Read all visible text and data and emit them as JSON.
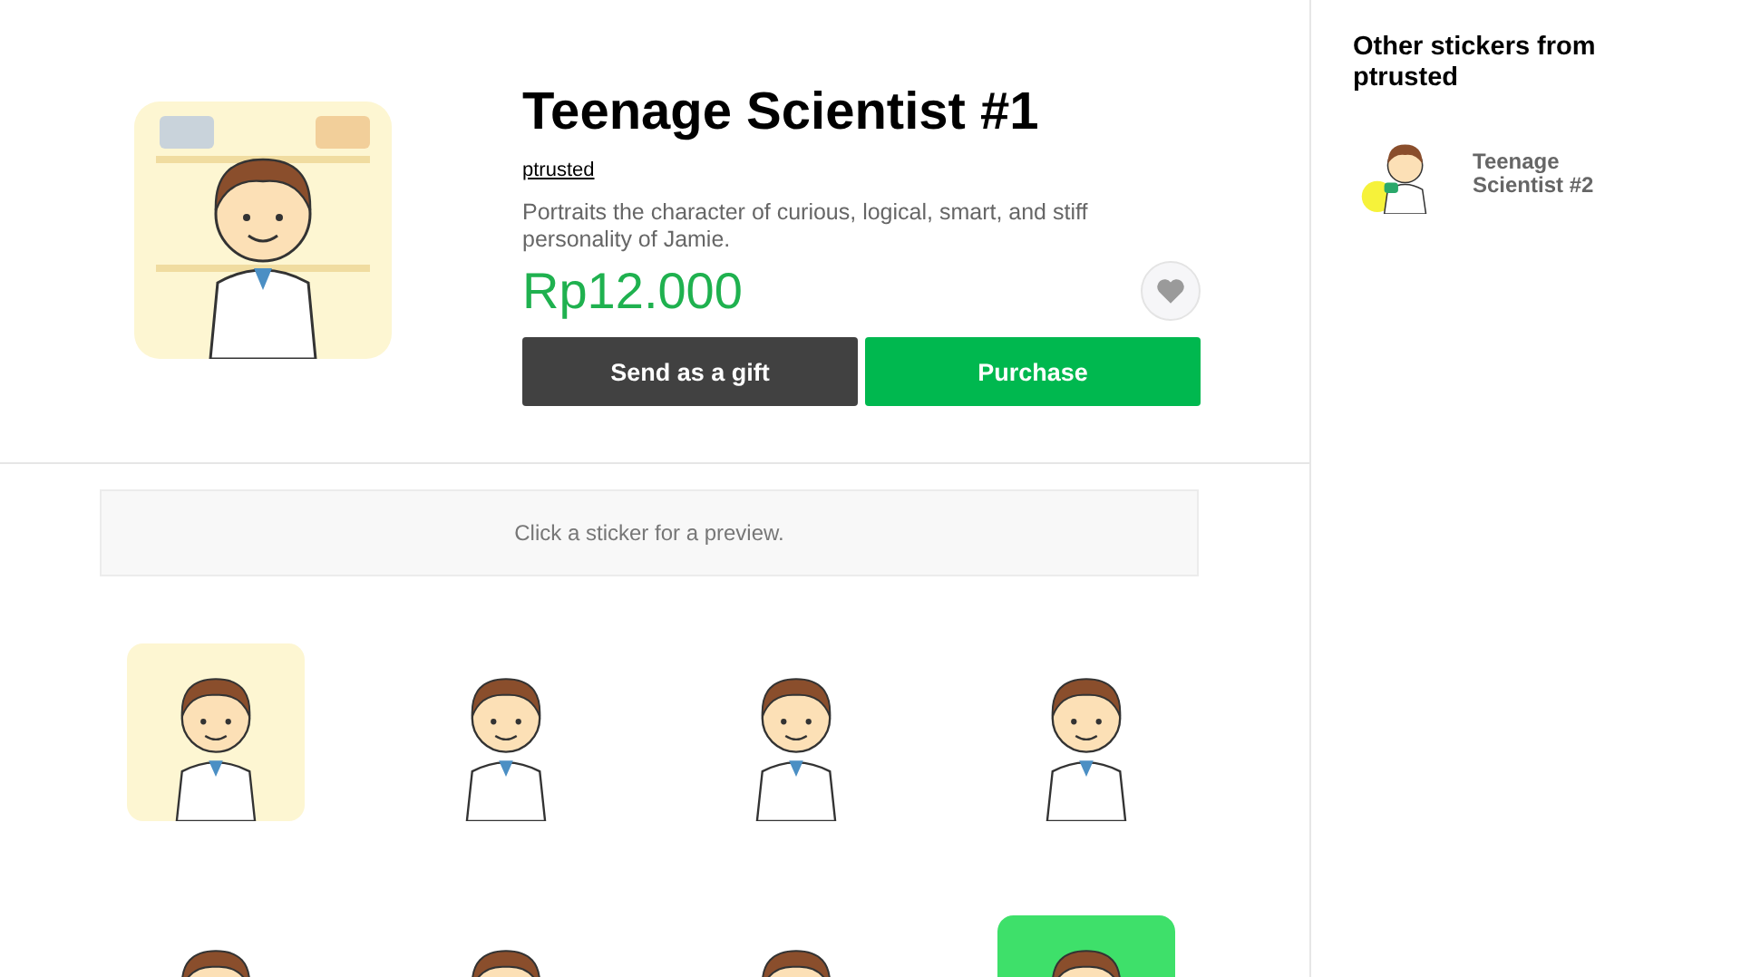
{
  "product": {
    "title": "Teenage Scientist #1",
    "author": "ptrusted",
    "description": "Portraits the character of curious, logical, smart, and stiff personality of Jamie.",
    "price": "Rp12.000",
    "favorited": false,
    "buttons": [
      {
        "kind": "gift",
        "label": "Send as a gift"
      },
      {
        "kind": "purchase",
        "label": "Purchase"
      }
    ]
  },
  "preview_hint": "Click a sticker for a preview.",
  "stickers": [
    {
      "kind": "lab"
    },
    {
      "kind": "plain"
    },
    {
      "kind": "plain"
    },
    {
      "kind": "plain"
    },
    {
      "kind": "plain"
    },
    {
      "kind": "plain"
    },
    {
      "kind": "plain"
    },
    {
      "kind": "green"
    }
  ],
  "sidebar": {
    "heading": "Other stickers from ptrusted",
    "items": [
      {
        "title": "Teenage Scientist #2"
      }
    ]
  }
}
